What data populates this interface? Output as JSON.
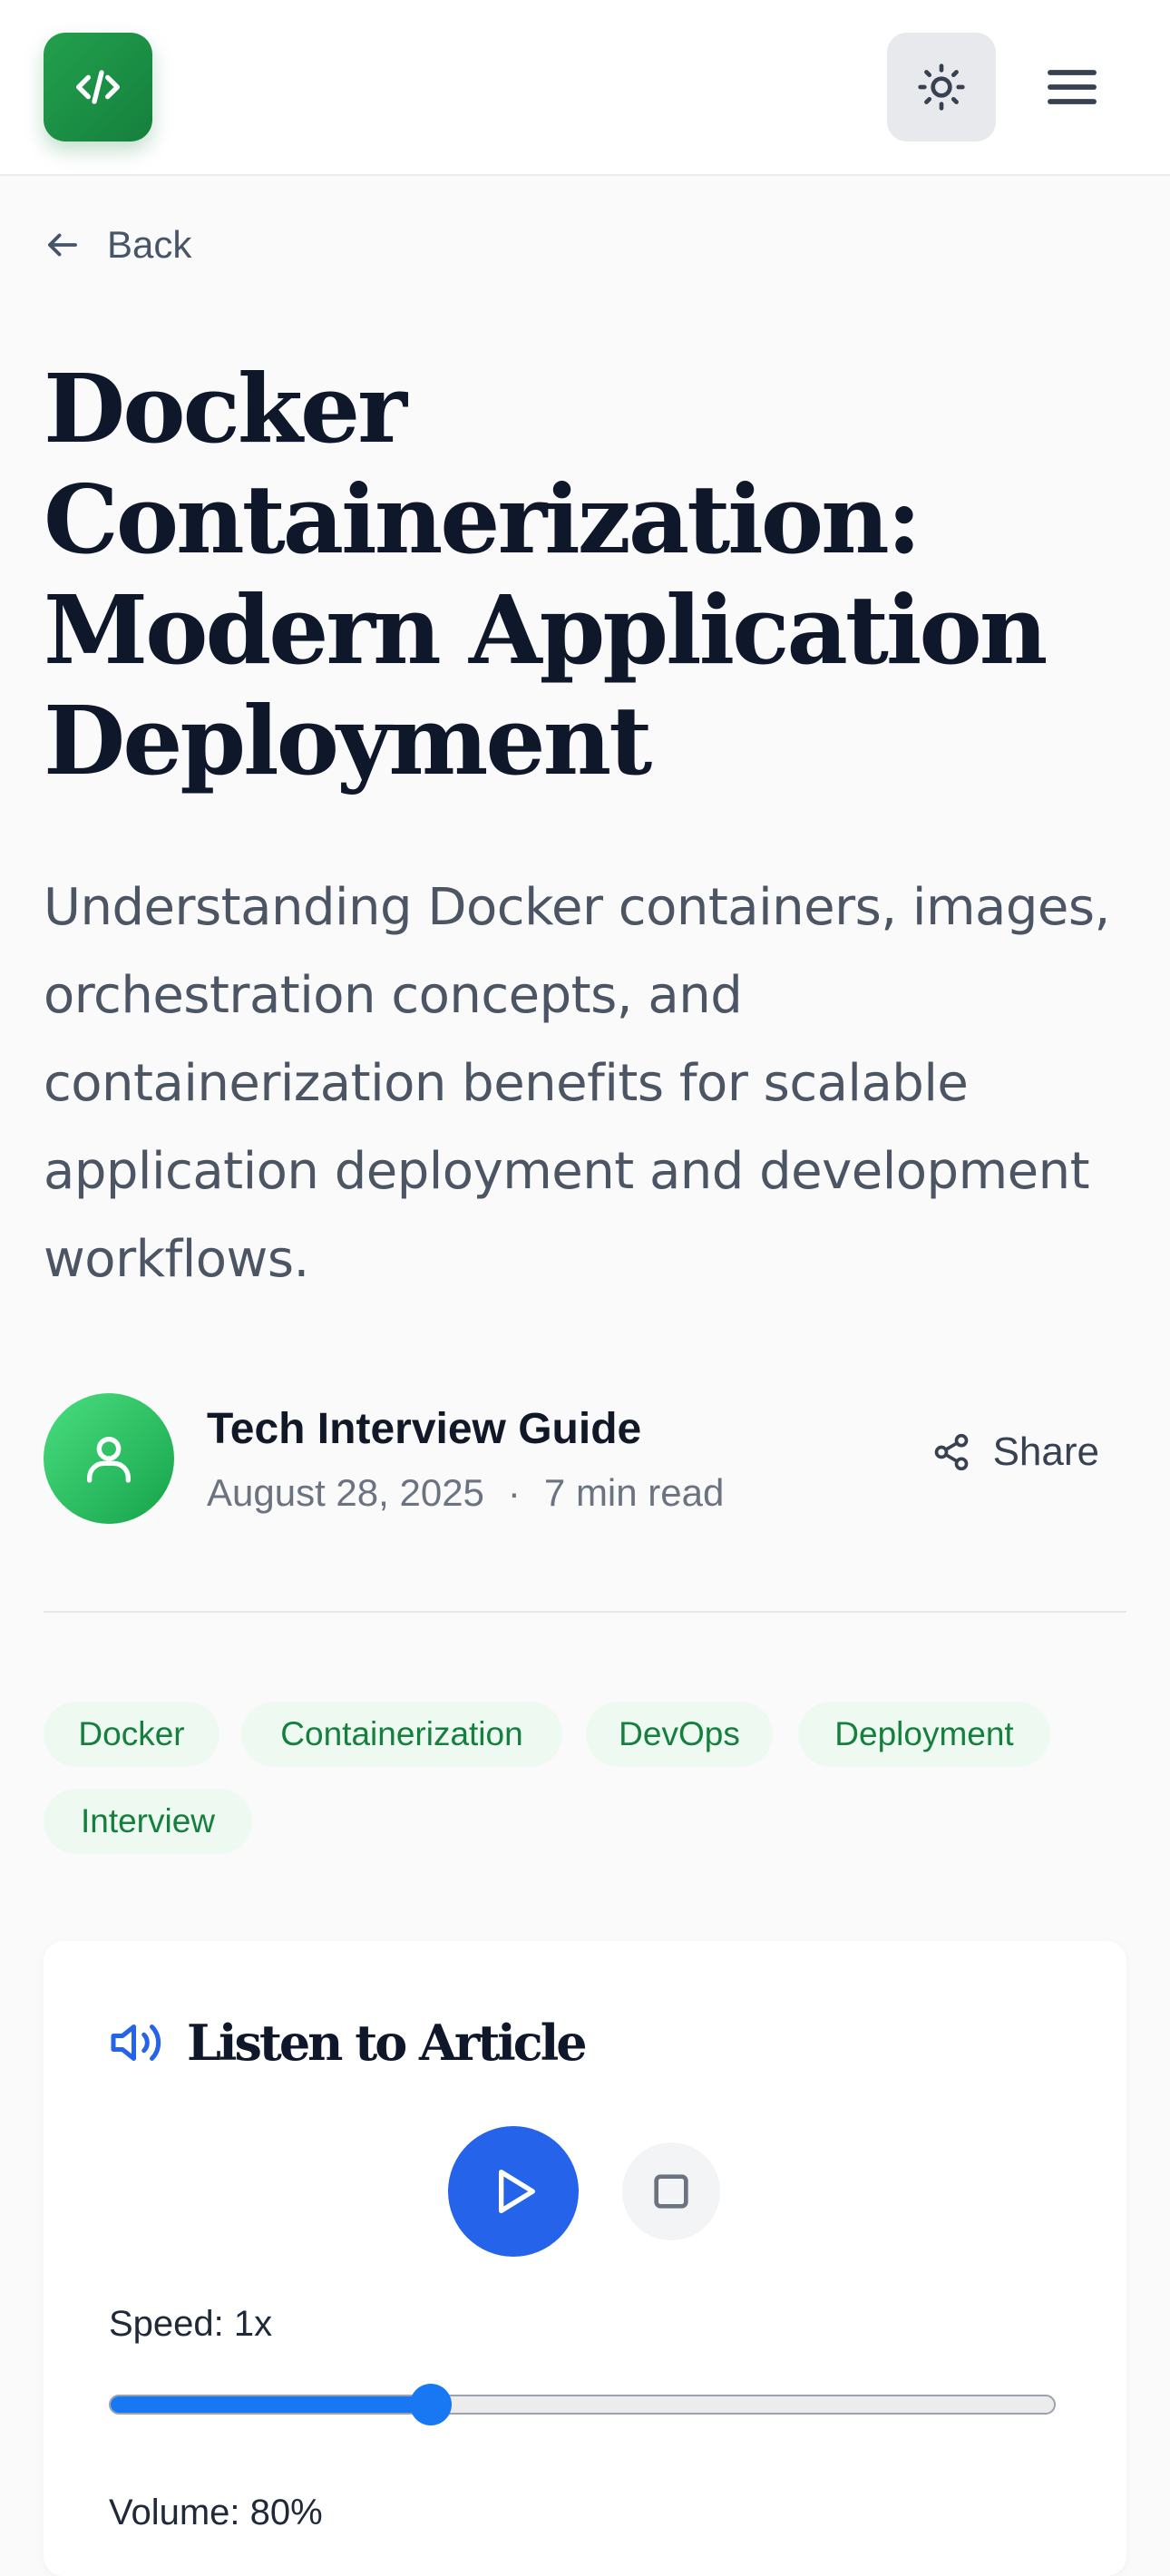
{
  "header": {
    "logo_icon": "code-icon",
    "theme_icon": "sun-icon",
    "menu_icon": "hamburger-menu-icon"
  },
  "nav": {
    "back_label": "Back"
  },
  "article": {
    "title": "Docker Containerization: Modern Application Deployment",
    "subtitle": "Understanding Docker containers, images, orchestration concepts, and containerization benefits for scalable application deployment and development workflows.",
    "author": "Tech Interview Guide",
    "date": "August 28, 2025",
    "separator": "·",
    "read_time": "7 min read",
    "share_label": "Share"
  },
  "tags": [
    "Docker",
    "Containerization",
    "DevOps",
    "Deployment",
    "Interview"
  ],
  "audio_player": {
    "title": "Listen to Article",
    "speed_label": "Speed: 1x",
    "speed_fraction": 0.34,
    "volume_label": "Volume: 80%"
  },
  "colors": {
    "brand_green": "#16a34a",
    "accent_blue": "#2563eb",
    "slider_blue": "#1877f2"
  }
}
